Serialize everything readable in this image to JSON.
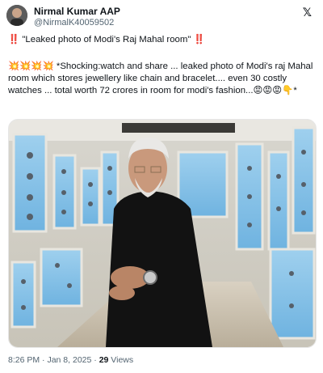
{
  "author": {
    "name": "Nirmal Kumar AAP",
    "handle": "@NirmalK40059502"
  },
  "header_line": {
    "prefix_emoji": "‼️",
    "text": " \"Leaked photo of Modi's Raj Mahal room\" ",
    "suffix_emoji": "‼️"
  },
  "body": {
    "lead_emoji": "💥💥💥💥",
    "text": " *Shocking:watch and share ... leaked photo of Modi's raj Mahal room which stores jewellery like chain and bracelet.... even 30 costly watches ... total worth 72 crores in room for modi's fashion...",
    "trail_emoji": "😡😡😡👇*"
  },
  "footer": {
    "time": "8:26 PM",
    "separator": " · ",
    "date": "Jan 8, 2025",
    "views_count": "29",
    "views_label": " Views"
  },
  "icons": {
    "platform": "x-logo"
  }
}
